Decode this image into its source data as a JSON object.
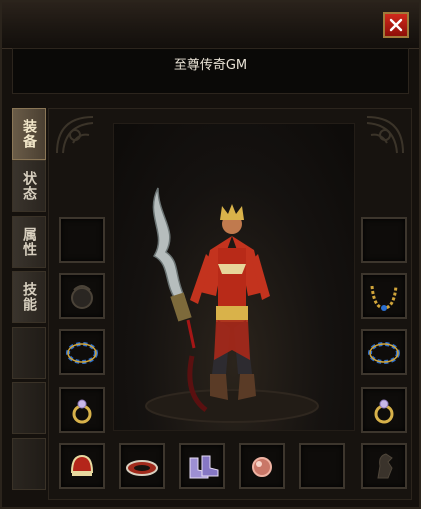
{
  "window": {
    "character_name": "至尊传奇GM"
  },
  "tabs": [
    {
      "label": "装备",
      "active": true
    },
    {
      "label": "状态",
      "active": false
    },
    {
      "label": "属性",
      "active": false
    },
    {
      "label": "技能",
      "active": false
    },
    {
      "label": "",
      "active": false
    },
    {
      "label": "",
      "active": false
    },
    {
      "label": "",
      "active": false
    }
  ],
  "slots": {
    "left": [
      "empty",
      "dim-amulet",
      "blue-bracelet",
      "gold-ring"
    ],
    "right": [
      "empty",
      "necklace",
      "blue-bracelet",
      "gold-ring"
    ],
    "bottom": [
      "red-helmet-orb",
      "red-belt",
      "purple-boots",
      "pink-gem",
      "empty",
      "horse-medal"
    ]
  },
  "colors": {
    "close_button": "#c41d12",
    "frame": "#3d362d",
    "tab_text": "#d7cfbf"
  }
}
